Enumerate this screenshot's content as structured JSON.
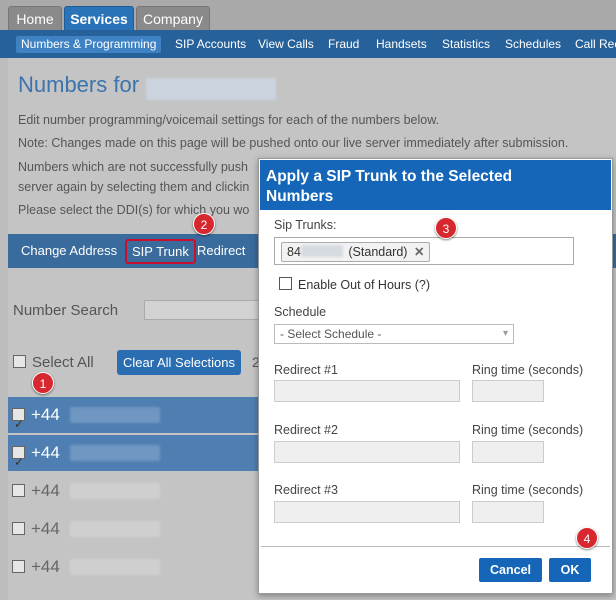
{
  "top_tabs": [
    {
      "label": "Home",
      "active": false
    },
    {
      "label": "Services",
      "active": true
    },
    {
      "label": "Company",
      "active": false
    }
  ],
  "subnav": [
    {
      "label": "Numbers & Programming",
      "active": true
    },
    {
      "label": "SIP Accounts"
    },
    {
      "label": "View Calls"
    },
    {
      "label": "Fraud"
    },
    {
      "label": "Handsets"
    },
    {
      "label": "Statistics"
    },
    {
      "label": "Schedules"
    },
    {
      "label": "Call Rec"
    }
  ],
  "page": {
    "title": "Numbers for",
    "para1": "Edit number programming/voicemail settings for each of the numbers below.",
    "para2": "Note: Changes made on this page will be pushed onto our live server immediately after submission.",
    "para3": "Numbers which are not successfully push",
    "para4": "server again by selecting them and clickin",
    "para5": "Please select the DDI(s) for which you wo"
  },
  "actionbar": {
    "change_address": "Change Address",
    "sip_trunk": "SIP Trunk",
    "redirect": "Redirect"
  },
  "search": {
    "label": "Number Search"
  },
  "list": {
    "select_all": "Select All",
    "clear_all": "Clear All Selections",
    "count_fragment": "2",
    "rows": [
      {
        "prefix": "+44",
        "checked": true
      },
      {
        "prefix": "+44",
        "checked": true
      },
      {
        "prefix": "+44",
        "checked": false
      },
      {
        "prefix": "+44",
        "checked": false
      },
      {
        "prefix": "+44",
        "checked": false
      }
    ]
  },
  "badges": [
    "1",
    "2",
    "3",
    "4"
  ],
  "modal": {
    "title_line1": "Apply a SIP Trunk to the Selected",
    "title_line2": "Numbers",
    "sip_trunks_label": "Sip Trunks:",
    "trunk_chip_prefix": "84",
    "trunk_chip_suffix": "(Standard)",
    "trunk_chip_remove": "✕",
    "enable_ooh": "Enable Out of Hours (?)",
    "schedule_label": "Schedule",
    "schedule_value": "- Select Schedule -",
    "redirect1": "Redirect #1",
    "redirect2": "Redirect #2",
    "redirect3": "Redirect #3",
    "ring_time": "Ring time (seconds)",
    "cancel": "Cancel",
    "ok": "OK"
  },
  "colors": {
    "accent": "#1566b8",
    "badge": "#d7282f"
  }
}
